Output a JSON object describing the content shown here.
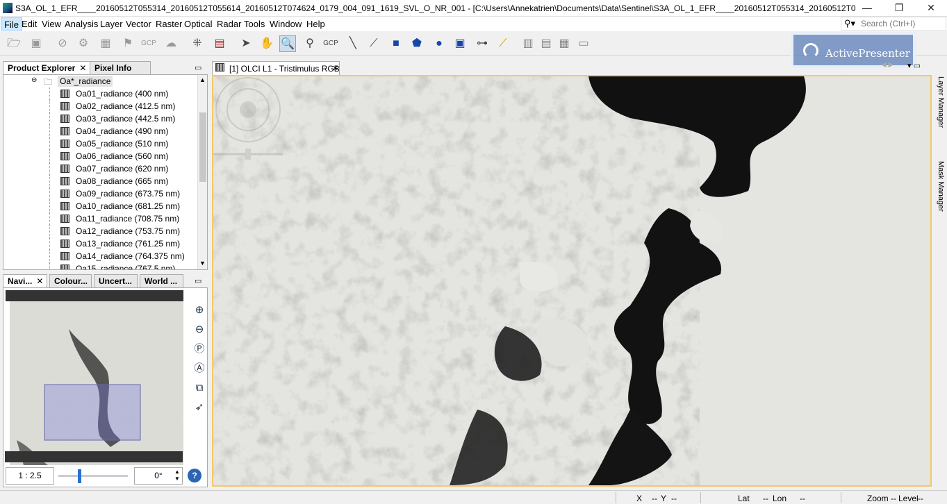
{
  "window": {
    "title": "S3A_OL_1_EFR____20160512T055314_20160512T055614_20160512T074624_0179_004_091_1619_SVL_O_NR_001 - [C:\\Users\\Annekatrien\\Documents\\Data\\Sentinel\\S3A_OL_1_EFR____20160512T055314_20160512T055614_20160512T07...",
    "minimize": "—",
    "restore": "❐",
    "close": "✕"
  },
  "menubar": {
    "items": [
      "File",
      "Edit",
      "View",
      "Analysis",
      "Layer",
      "Vector",
      "Raster",
      "Optical",
      "Radar",
      "Tools",
      "Window",
      "Help"
    ]
  },
  "search": {
    "placeholder": "Search (Ctrl+I)"
  },
  "watermark": {
    "text": "ActivePresenter"
  },
  "product_explorer": {
    "tabs": [
      "Product Explorer",
      "Pixel Info"
    ],
    "folder": "Oa*_radiance",
    "bands": [
      "Oa01_radiance (400 nm)",
      "Oa02_radiance (412.5 nm)",
      "Oa03_radiance (442.5 nm)",
      "Oa04_radiance (490 nm)",
      "Oa05_radiance (510 nm)",
      "Oa06_radiance (560 nm)",
      "Oa07_radiance (620 nm)",
      "Oa08_radiance (665 nm)",
      "Oa09_radiance (673.75 nm)",
      "Oa10_radiance (681.25 nm)",
      "Oa11_radiance (708.75 nm)",
      "Oa12_radiance (753.75 nm)",
      "Oa13_radiance (761.25 nm)",
      "Oa14_radiance (764.375 nm)",
      "Oa15_radiance (767.5 nm)"
    ]
  },
  "navigation": {
    "tabs": [
      "Navi...",
      "Colour...",
      "Uncert...",
      "World ..."
    ],
    "scale": "1 : 2.5",
    "rotation": "0°",
    "zoom_slider_fraction": 0.28
  },
  "image_view": {
    "tab_label": "[1] OLCI L1 - Tristimulus RGB"
  },
  "side_tabs": [
    "Layer Manager",
    "Mask Manager"
  ],
  "statusbar": {
    "x_label": "X",
    "x_value": "--",
    "y_label": "Y",
    "y_value": "--",
    "lat_label": "Lat",
    "lat_value": "--",
    "lon_label": "Lon",
    "lon_value": "--",
    "zoom_label": "Zoom",
    "zoom_value": "--",
    "level_label": "Level",
    "level_value": "--"
  },
  "colors": {
    "selection": "#cce8ff",
    "view_border": "#f3c86a",
    "ice": "#e6e6e2",
    "water": "#0f0f0f"
  }
}
